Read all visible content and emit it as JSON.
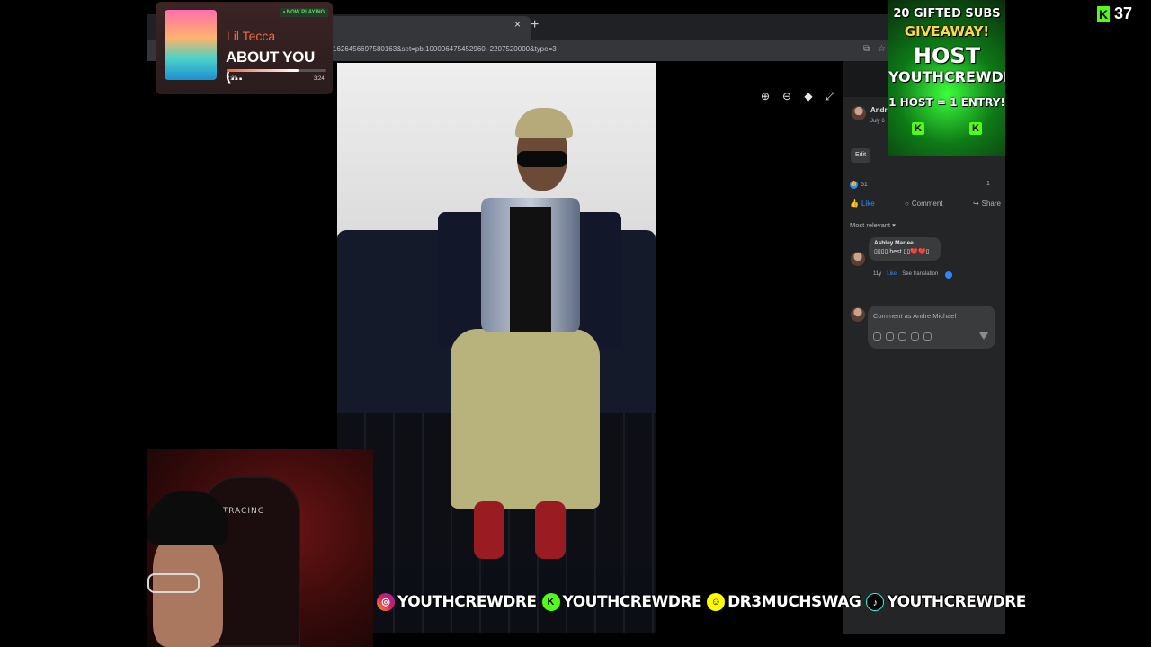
{
  "browser": {
    "url": "1626456697580163&set=pb.100006475452960.-2207520000&type=3",
    "tab_close": "×",
    "new_tab": "+"
  },
  "viewer_tools": [
    "zoom-in-icon",
    "zoom-out-icon",
    "tag-icon",
    "fullscreen-icon"
  ],
  "post": {
    "author": "Andre",
    "date": "July 6",
    "edit_label": "Edit",
    "reaction_count": "51",
    "comment_count": "1",
    "actions": {
      "like": "Like",
      "comment": "Comment",
      "share": "Share"
    },
    "sort_label": "Most relevant",
    "comments": [
      {
        "name": "Ashley Mariee",
        "text": "▯▯▯▯ best ▯▯❤️❤️▯",
        "age": "11y",
        "like": "Like",
        "translate": "See translation"
      }
    ],
    "compose_placeholder": "Comment as Andre Michael"
  },
  "now_playing": {
    "badge": "• NOW PLAYING",
    "artist": "Lil Tecca",
    "track": "ABOUT YOU (...",
    "elapsed": "2:29",
    "total": "3:24",
    "progress": 0.73
  },
  "giveaway": {
    "line1": "20 GIFTED SUBS",
    "line2": "GIVEAWAY!",
    "line3": "HOST",
    "line4": "YOUTHCREWDRE",
    "line5": "1 HOST = 1 ENTRY!"
  },
  "viewer_count": "37",
  "socials": [
    {
      "platform": "instagram",
      "handle": "YOUTHCREWDRE"
    },
    {
      "platform": "kick",
      "handle": "YOUTHCREWDRE"
    },
    {
      "platform": "snapchat",
      "handle": "DR3MUCHSWAG"
    },
    {
      "platform": "tiktok",
      "handle": "YOUTHCREWDRE"
    }
  ],
  "webcam": {
    "chair_logo": "GTRACING"
  },
  "colors": {
    "fb_blue": "#2d88ff",
    "kick_green": "#53fc18",
    "artist_orange": "#f06a3e"
  }
}
